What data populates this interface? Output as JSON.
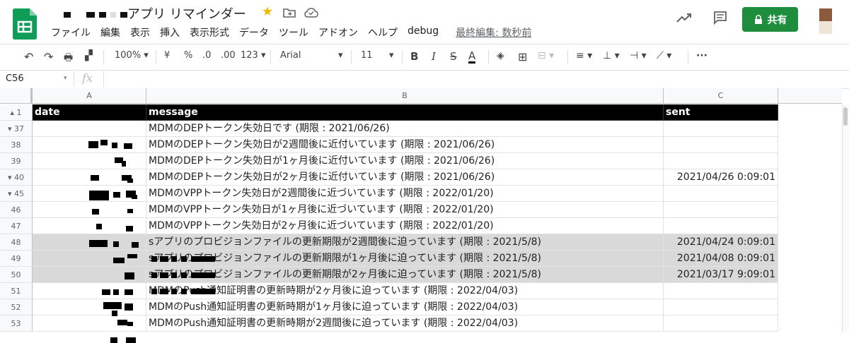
{
  "app": {
    "title": "アプリ リマインダー",
    "menu": [
      "ファイル",
      "編集",
      "表示",
      "挿入",
      "表示形式",
      "データ",
      "ツール",
      "アドオン",
      "ヘルプ",
      "debug"
    ],
    "last_edit": "最終編集: 数秒前",
    "share_label": "共有"
  },
  "toolbar": {
    "zoom": "100%",
    "currency": "¥",
    "percent": "%",
    "dec_less": ".0",
    "dec_more": ".00",
    "more_formats": "123",
    "font": "Arial",
    "font_size": "11",
    "bold": "B",
    "italic": "I",
    "strike": "S",
    "text_color": "A",
    "more": "···"
  },
  "formula_bar": {
    "cell_ref": "C56",
    "fx": "fx",
    "value": ""
  },
  "columns": [
    "A",
    "B",
    "C"
  ],
  "header_row": {
    "num": "1",
    "a": "date",
    "b": "message",
    "c": "sent"
  },
  "rows": [
    {
      "num": "37",
      "b": "MDMのDEPトークン失効日です (期限 : 2021/06/26)",
      "c": ""
    },
    {
      "num": "38",
      "b": "MDMのDEPトークン失効日が2週間後に近付いています (期限 : 2021/06/26)",
      "c": ""
    },
    {
      "num": "39",
      "b": "MDMのDEPトークン失効日が1ヶ月後に近付いています (期限 : 2021/06/26)",
      "c": ""
    },
    {
      "num": "40",
      "b": "MDMのDEPトークン失効日が2ヶ月後に近付いています (期限 : 2021/06/26)",
      "c": "2021/04/26 0:09:01"
    },
    {
      "num": "45",
      "b": "MDMのVPPトークン失効日が2週間後に近づいています (期限 : 2022/01/20)",
      "c": ""
    },
    {
      "num": "46",
      "b": "MDMのVPPトークン失効日が1ヶ月後に近づいています (期限 : 2022/01/20)",
      "c": ""
    },
    {
      "num": "47",
      "b": "MDMのVPPトークン失効日が2ヶ月後に近づいています (期限 : 2022/01/20)",
      "c": ""
    },
    {
      "num": "48",
      "b": "sアプリのプロビジョンファイルの更新期限が2週間後に迫っています (期限 : 2021/5/8)",
      "c": "2021/04/24 0:09:01"
    },
    {
      "num": "49",
      "b": "sアプリのプロビジョンファイルの更新期限が1ヶ月後に迫っています (期限 : 2021/5/8)",
      "c": "2021/04/08 0:09:01"
    },
    {
      "num": "50",
      "b": "sアプリのプロビジョンファイルの更新期限が2ヶ月後に迫っています (期限 : 2021/5/8)",
      "c": "2021/03/17 9:09:01"
    },
    {
      "num": "51",
      "b": "MDMのPush通知証明書の更新時期が2ヶ月後に迫っています (期限 : 2022/04/03)",
      "c": ""
    },
    {
      "num": "52",
      "b": "MDMのPush通知証明書の更新時期が1ヶ月後に迫っています (期限 : 2022/04/03)",
      "c": ""
    },
    {
      "num": "53",
      "b": "MDMのPush通知証明書の更新時期が2週間後に迫っています (期限 : 2022/04/03)",
      "c": ""
    }
  ],
  "colors": {
    "share": "#1e8e3e",
    "header_bg": "#000000",
    "highlight_row": "#d9d9d9",
    "sheets_green": "#0f9d58"
  }
}
